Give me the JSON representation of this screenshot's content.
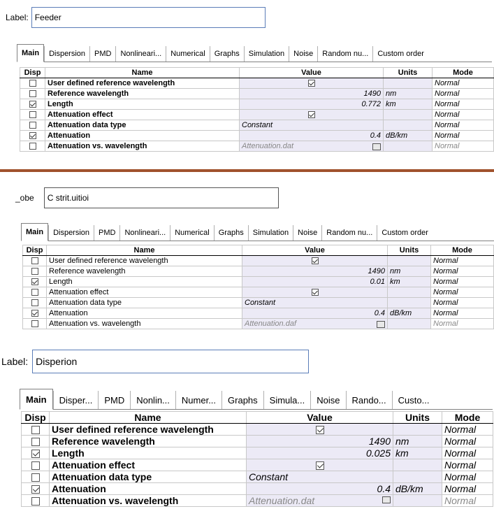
{
  "panels": [
    {
      "label_caption": "Label:",
      "label_value": "Feeder",
      "tabs": [
        "Main",
        "Dispersion",
        "PMD",
        "Nonlineari...",
        "Numerical",
        "Graphs",
        "Simulation",
        "Noise",
        "Random nu...",
        "Custom order"
      ],
      "headers": {
        "disp": "Disp",
        "name": "Name",
        "value": "Value",
        "units": "Units",
        "mode": "Mode"
      },
      "rows": [
        {
          "checked": false,
          "name": "User defined reference wavelength",
          "value": "",
          "value_checkbox": true,
          "value_checked": true,
          "units": "",
          "mode": "Normal"
        },
        {
          "checked": false,
          "name": "Reference wavelength",
          "value": "1490",
          "units": "nm",
          "mode": "Normal"
        },
        {
          "checked": true,
          "name": "Length",
          "value": "0.772",
          "units": "km",
          "mode": "Normal"
        },
        {
          "checked": false,
          "name": "Attenuation effect",
          "value": "",
          "value_checkbox": true,
          "value_checked": true,
          "units": "",
          "mode": "Normal"
        },
        {
          "checked": false,
          "name": "Attenuation data type",
          "value": "Constant",
          "units": "",
          "mode": "Normal"
        },
        {
          "checked": true,
          "name": "Attenuation",
          "value": "0.4",
          "units": "dB/km",
          "mode": "Normal"
        },
        {
          "checked": false,
          "name": "Attenuation vs. wavelength",
          "value": "Attenuation.dat",
          "units": "",
          "mode": "Normal"
        }
      ]
    },
    {
      "label_caption": "_obe",
      "label_value": "C strit.uitioi",
      "tabs": [
        "Main",
        "Dispersion",
        "PMD",
        "Nonlineari...",
        "Numerical",
        "Graphs",
        "Simulation",
        "Noise",
        "Random nu...",
        "Custom order"
      ],
      "headers": {
        "disp": "Disp",
        "name": "Name",
        "value": "Value",
        "units": "Units",
        "mode": "Mode"
      },
      "rows": [
        {
          "checked": false,
          "name": "User defined reference wavelength",
          "value": "",
          "value_checkbox": true,
          "value_checked": true,
          "units": "",
          "mode": "Normal"
        },
        {
          "checked": false,
          "name": "Reference wavelength",
          "value": "1490",
          "units": "nm",
          "mode": "Normal"
        },
        {
          "checked": true,
          "name": "Length",
          "value": "0.01",
          "units": "km",
          "mode": "Normal"
        },
        {
          "checked": false,
          "name": "Attenuation effect",
          "value": "",
          "value_checkbox": true,
          "value_checked": true,
          "units": "",
          "mode": "Normal"
        },
        {
          "checked": false,
          "name": "Attenuation data type",
          "value": "Constant",
          "units": "",
          "mode": "Normal"
        },
        {
          "checked": true,
          "name": "Attenuation",
          "value": "0.4",
          "units": "dB/km",
          "mode": "Normal"
        },
        {
          "checked": false,
          "name": "Attenuation vs. wavelength",
          "value": "Attenuation.daf",
          "units": "",
          "mode": "Normal"
        }
      ]
    },
    {
      "label_caption": "Label:",
      "label_value": "Disperion",
      "tabs": [
        "Main",
        "Disper...",
        "PMD",
        "Nonlin...",
        "Numer...",
        "Graphs",
        "Simula...",
        "Noise",
        "Rando...",
        "Custo..."
      ],
      "headers": {
        "disp": "Disp",
        "name": "Name",
        "value": "Value",
        "units": "Units",
        "mode": "Mode"
      },
      "rows": [
        {
          "checked": false,
          "name": "User defined reference wavelength",
          "value": "",
          "value_checkbox": true,
          "value_checked": true,
          "units": "",
          "mode": "Normal"
        },
        {
          "checked": false,
          "name": "Reference wavelength",
          "value": "1490",
          "units": "nm",
          "mode": "Normal"
        },
        {
          "checked": true,
          "name": "Length",
          "value": "0.025",
          "units": "km",
          "mode": "Normal"
        },
        {
          "checked": false,
          "name": "Attenuation effect",
          "value": "",
          "value_checkbox": true,
          "value_checked": true,
          "units": "",
          "mode": "Normal"
        },
        {
          "checked": false,
          "name": "Attenuation data type",
          "value": "Constant",
          "units": "",
          "mode": "Normal"
        },
        {
          "checked": true,
          "name": "Attenuation",
          "value": "0.4",
          "units": "dB/km",
          "mode": "Normal"
        },
        {
          "checked": false,
          "name": "Attenuation vs. wavelength",
          "value": "Attenuation.dat",
          "units": "",
          "mode": "Normal"
        }
      ]
    }
  ]
}
